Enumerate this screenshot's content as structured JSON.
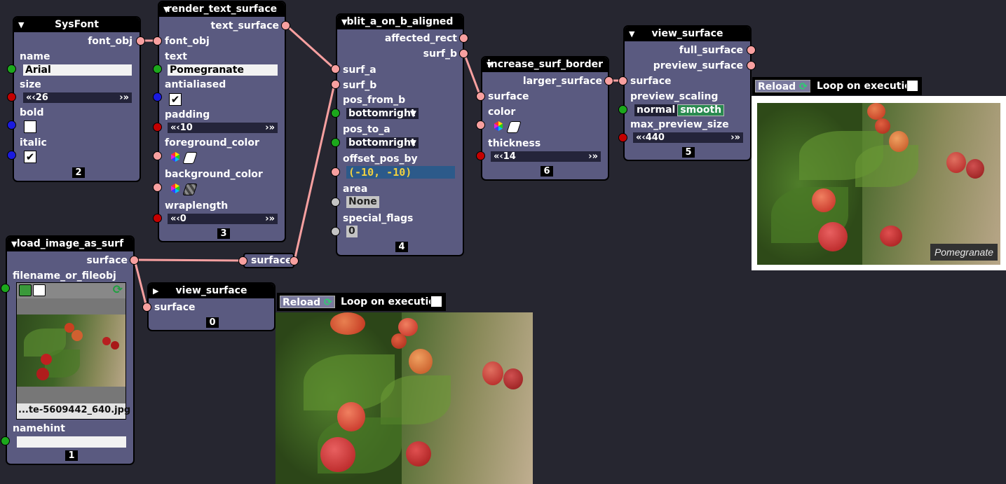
{
  "colors": {
    "canvas": "#262630",
    "node_bg": "#5a5a80",
    "link": "#f8a0a0"
  },
  "nodes": {
    "sysfont": {
      "title": "SysFont",
      "out_font_obj": "font_obj",
      "name_label": "name",
      "name_value": "Arial",
      "size_label": "size",
      "size_value": "26",
      "bold_label": "bold",
      "bold_checked": false,
      "italic_label": "italic",
      "italic_checked": true,
      "id": "2"
    },
    "render_text_surface": {
      "title": "render_text_surface",
      "out_text_surface": "text_surface",
      "font_obj_label": "font_obj",
      "text_label": "text",
      "text_value": "Pomegranate",
      "antialiased_label": "antialiased",
      "antialiased_checked": true,
      "padding_label": "padding",
      "padding_value": "10",
      "fg_label": "foreground_color",
      "bg_label": "background_color",
      "wraplength_label": "wraplength",
      "wraplength_value": "0",
      "id": "3"
    },
    "blit": {
      "title": "blit_a_on_b_aligned",
      "out_affected_rect": "affected_rect",
      "out_surf_b": "surf_b",
      "surf_a_label": "surf_a",
      "surf_b_label": "surf_b",
      "pos_from_b_label": "pos_from_b",
      "pos_from_b_value": "bottomright",
      "pos_to_a_label": "pos_to_a",
      "pos_to_a_value": "bottomright",
      "offset_label": "offset_pos_by",
      "offset_value": "(-10, -10)",
      "area_label": "area",
      "area_value": "None",
      "flags_label": "special_flags",
      "flags_value": "0",
      "id": "4"
    },
    "border": {
      "title": "increase_surf_border",
      "out_larger": "larger_surface",
      "surface_label": "surface",
      "color_label": "color",
      "thickness_label": "thickness",
      "thickness_value": "14",
      "id": "6"
    },
    "view5": {
      "title": "view_surface",
      "out_full": "full_surface",
      "out_preview": "preview_surface",
      "surface_label": "surface",
      "scaling_label": "preview_scaling",
      "scaling_opt1": "normal",
      "scaling_opt2": "smooth",
      "max_label": "max_preview_size",
      "max_value": "440",
      "id": "5"
    },
    "load": {
      "title": "load_image_as_surf",
      "out_surface": "surface",
      "filename_label": "filename_or_fileobj",
      "filename_value": "...te-5609442_640.jpg",
      "namehint_label": "namehint",
      "namehint_value": "",
      "id": "1"
    },
    "view0": {
      "title": "view_surface",
      "surface_label": "surface",
      "id": "0"
    },
    "reroute": {
      "label": "surface"
    }
  },
  "toolbars": {
    "reload_label": "Reload",
    "loop_label": "Loop on execution"
  },
  "preview_caption": "Pomegranate",
  "icons": [
    "collapse-arrow-icon",
    "checkbox-check-icon",
    "color-wheel-icon",
    "folder-icon",
    "image-icon",
    "reload-icon"
  ]
}
